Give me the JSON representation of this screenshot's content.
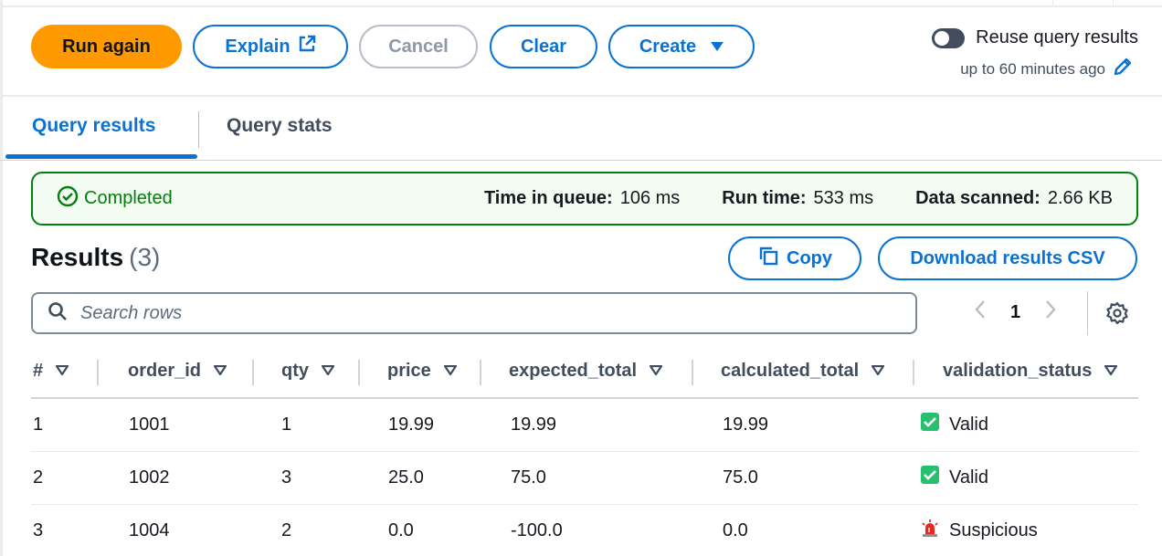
{
  "toolbar": {
    "run_again": "Run again",
    "explain": "Explain",
    "cancel": "Cancel",
    "clear": "Clear",
    "create": "Create"
  },
  "reuse": {
    "label": "Reuse query results",
    "sub": "up to 60 minutes ago",
    "enabled": false
  },
  "tabs": [
    {
      "label": "Query results",
      "active": true
    },
    {
      "label": "Query stats",
      "active": false
    }
  ],
  "status": {
    "state": "Completed",
    "queue_label": "Time in queue:",
    "queue_value": "106 ms",
    "run_label": "Run time:",
    "run_value": "533 ms",
    "scanned_label": "Data scanned:",
    "scanned_value": "2.66 KB"
  },
  "results": {
    "title": "Results",
    "count": "(3)",
    "copy": "Copy",
    "download": "Download results CSV"
  },
  "search": {
    "placeholder": "Search rows"
  },
  "pagination": {
    "current": "1"
  },
  "table": {
    "columns": [
      "#",
      "order_id",
      "qty",
      "price",
      "expected_total",
      "calculated_total",
      "validation_status"
    ],
    "rows": [
      [
        "1",
        "1001",
        "1",
        "19.99",
        "19.99",
        "19.99",
        "Valid"
      ],
      [
        "2",
        "1002",
        "3",
        "25.0",
        "75.0",
        "75.0",
        "Valid"
      ],
      [
        "3",
        "1004",
        "2",
        "0.0",
        "-100.0",
        "0.0",
        "Suspicious"
      ]
    ],
    "status_icons": [
      "check-box-icon",
      "check-box-icon",
      "siren-icon"
    ]
  },
  "colors": {
    "primary": "#ff9900",
    "link": "#0972d3",
    "success": "#037f0c",
    "success_bg": "#f2fcf3"
  }
}
